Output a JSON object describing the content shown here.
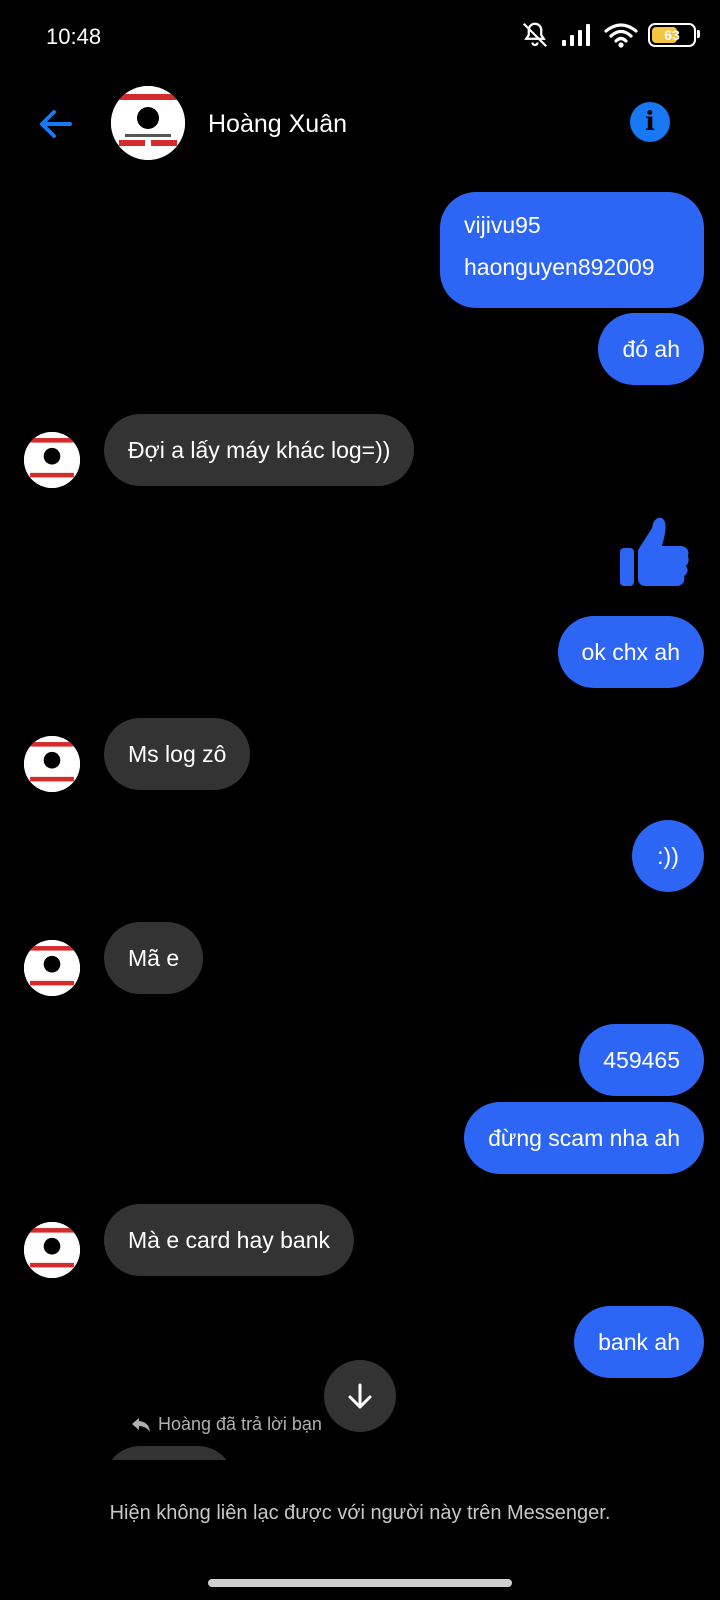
{
  "status_bar": {
    "time": "10:48",
    "battery": "63",
    "battery_level": 0.63,
    "icons": [
      "bell-muted-icon",
      "signal-icon",
      "wifi-icon",
      "battery-icon"
    ]
  },
  "header": {
    "contact_name": "Hoàng Xuân",
    "back_icon": "arrow-left-icon",
    "info_icon": "info-icon"
  },
  "colors": {
    "accent": "#1877f2",
    "outgoing_bubble": "#2d66f4",
    "incoming_bubble": "#333334",
    "background": "#000000"
  },
  "messages": [
    {
      "dir": "out",
      "text": "vijivu95 haonguyen892009"
    },
    {
      "dir": "out",
      "text": "đó ah"
    },
    {
      "dir": "in",
      "text": "Đợi a lấy máy khác log=))"
    },
    {
      "dir": "out",
      "icon": "thumbs-up-icon"
    },
    {
      "dir": "out",
      "text": "ok chx ah"
    },
    {
      "dir": "in",
      "text": "Ms log zô"
    },
    {
      "dir": "out",
      "text": ":))"
    },
    {
      "dir": "in",
      "text": "Mã e"
    },
    {
      "dir": "out",
      "text": "459465"
    },
    {
      "dir": "out",
      "text": "đừng scam nha ah"
    },
    {
      "dir": "in",
      "text": "Mà e card hay bank"
    },
    {
      "dir": "out",
      "text": "bank ah"
    }
  ],
  "bubble_texts": {
    "m1a": "vijivu95",
    "m1b": "haonguyen892009",
    "m2": "đó ah",
    "m3": "Đợi a lấy máy khác log=))",
    "m5": "ok chx ah",
    "m6": "Ms log zô",
    "m7": ":))",
    "m8": "Mã e",
    "m9": "459465",
    "m10": "đừng scam nha ah",
    "m11": "Mà e card hay bank",
    "m12": "bank ah"
  },
  "reply_note": "Hoàng đã trả lời bạn",
  "footer_notice": "Hiện không liên lạc được với người này trên Messenger."
}
